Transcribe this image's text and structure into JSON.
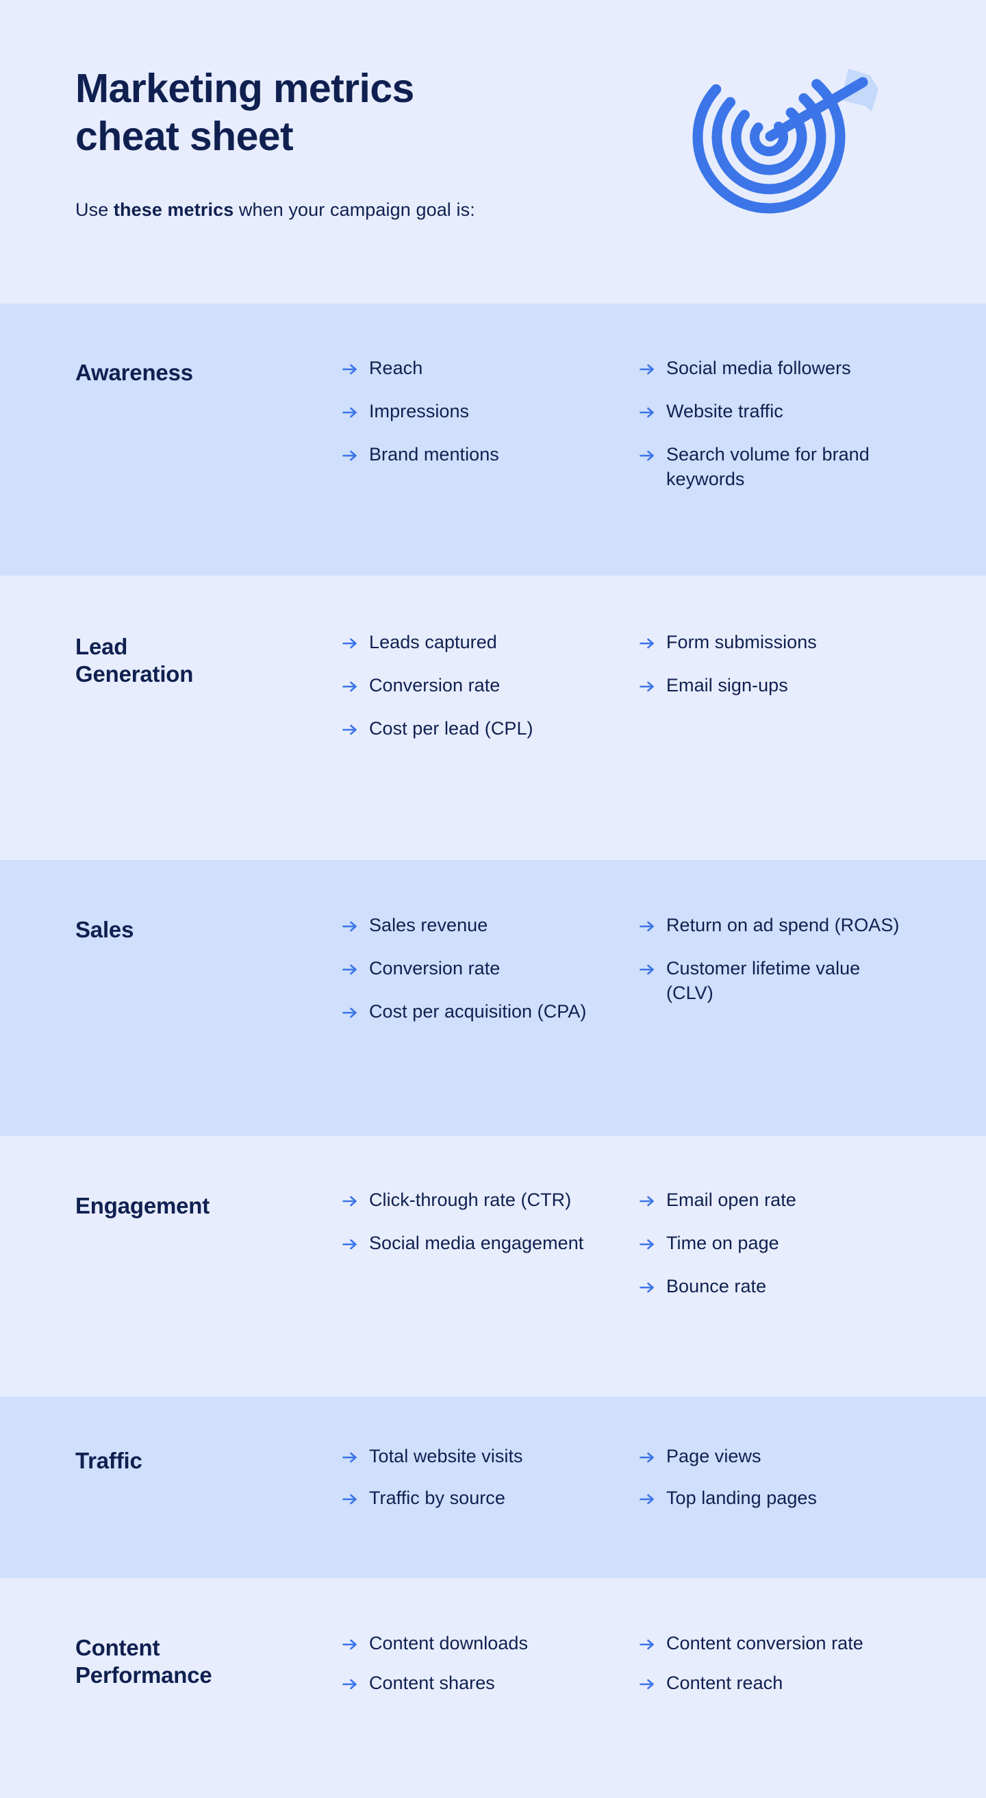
{
  "header": {
    "title": "Marketing metrics\ncheat sheet",
    "subtitle_prefix": "Use ",
    "subtitle_bold": "these metrics",
    "subtitle_suffix": " when your campaign goal is:",
    "icon": "target-bullseye-arrow-icon"
  },
  "colors": {
    "band_dark": "#cfdffc",
    "band_light": "#e8edfd",
    "text_navy": "#0f2050",
    "accent_blue": "#3b75e8",
    "icon_blue": "#3b75e8",
    "icon_fletching": "#c5d9fb"
  },
  "sections": [
    {
      "category": "Awareness",
      "columns": [
        [
          "Reach",
          "Impressions",
          "Brand mentions"
        ],
        [
          "Social media followers",
          "Website traffic",
          "Search volume for brand keywords"
        ]
      ]
    },
    {
      "category": "Lead\nGeneration",
      "columns": [
        [
          "Leads captured",
          "Conversion rate",
          "Cost per lead (CPL)"
        ],
        [
          "Form submissions",
          "Email sign-ups"
        ]
      ]
    },
    {
      "category": "Sales",
      "columns": [
        [
          "Sales revenue",
          "Conversion rate",
          "Cost per acquisition (CPA)"
        ],
        [
          "Return on ad spend (ROAS)",
          "Customer lifetime value (CLV)"
        ]
      ]
    },
    {
      "category": "Engagement",
      "columns": [
        [
          "Click-through rate (CTR)",
          "Social media engagement"
        ],
        [
          "Email open rate",
          "Time on page",
          "Bounce rate"
        ]
      ]
    },
    {
      "category": "Traffic",
      "columns": [
        [
          "Total website visits",
          "Traffic by source"
        ],
        [
          "Page views",
          "Top landing pages"
        ]
      ]
    },
    {
      "category": "Content\nPerformance",
      "columns": [
        [
          "Content downloads",
          "Content shares"
        ],
        [
          "Content conversion rate",
          "Content reach"
        ]
      ]
    }
  ]
}
